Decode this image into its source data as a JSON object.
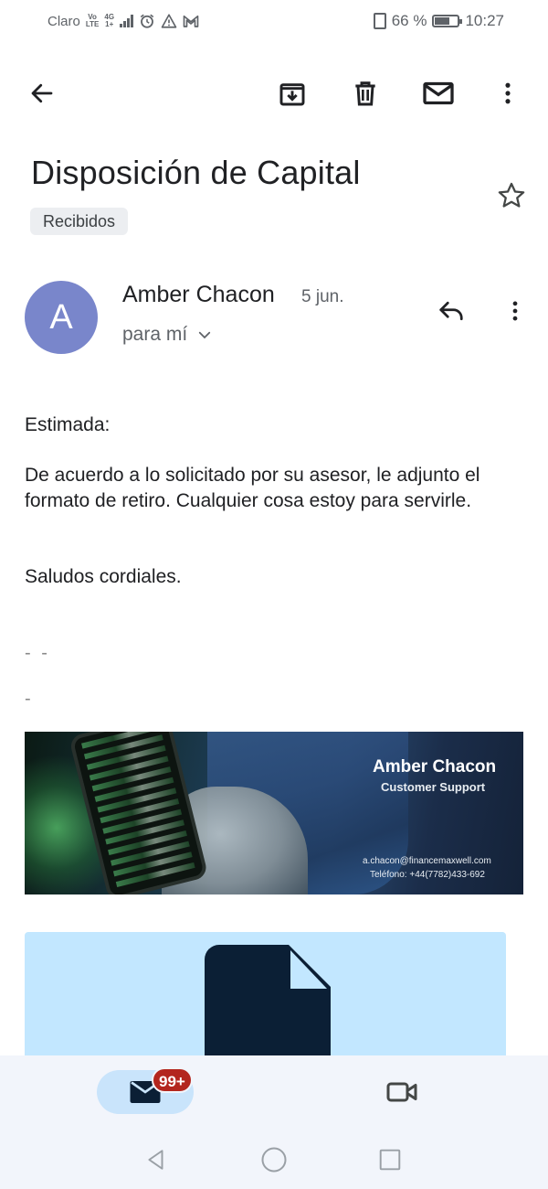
{
  "status_bar": {
    "carrier": "Claro",
    "volte_top": "Vo",
    "volte_bottom": "LTE",
    "net_top": "4G",
    "net_bottom": "1+",
    "battery_text": "66 %",
    "battery_level": 0.66,
    "time": "10:27",
    "icons": [
      "signal-icon",
      "alarm-icon",
      "warning-icon",
      "gmail-icon",
      "vibrate-icon",
      "battery-icon"
    ]
  },
  "toolbar": {
    "icons": [
      "back-arrow-icon",
      "archive-icon",
      "trash-icon",
      "mark-unread-icon",
      "more-vert-icon"
    ]
  },
  "email": {
    "subject": "Disposición de Capital",
    "label": "Recibidos",
    "sender": {
      "initial": "A",
      "name": "Amber Chacon",
      "date": "5 jun.",
      "recipient": "para mí"
    },
    "body": {
      "greeting": "Estimada:",
      "paragraph": "De acuerdo a lo solicitado por su asesor, le adjunto el formato de retiro. Cualquier cosa estoy para servirle.",
      "closing": "Saludos cordiales.",
      "sig_separator_1": "- -",
      "sig_separator_2": "-"
    },
    "signature_banner": {
      "name": "Amber Chacon",
      "role": "Customer Support",
      "email": "a.chacon@financemaxwell.com",
      "phone": "Teléfono: +44(7782)433-692"
    },
    "attachment": {
      "icon": "file-icon"
    }
  },
  "bottom_nav": {
    "mail_badge": "99+",
    "icons": [
      "mail-icon",
      "video-camera-icon"
    ]
  },
  "system_nav": {
    "icons": [
      "back-triangle-icon",
      "home-circle-icon",
      "recents-square-icon"
    ]
  },
  "colors": {
    "avatar": "#7986cb",
    "badge": "#b3261e",
    "attachment_bg": "#c2e7ff",
    "nav_active": "#c9e4fb",
    "file_icon": "#0b1f35"
  }
}
